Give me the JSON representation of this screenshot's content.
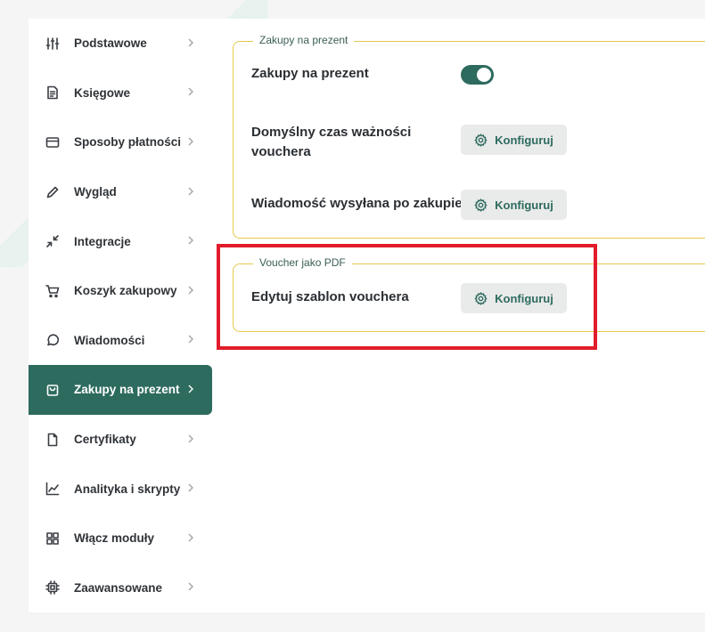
{
  "sidebar": {
    "items": [
      {
        "label": "Podstawowe",
        "icon": "sliders-icon"
      },
      {
        "label": "Księgowe",
        "icon": "document-icon"
      },
      {
        "label": "Sposoby płatności",
        "icon": "credit-card-icon"
      },
      {
        "label": "Wygląd",
        "icon": "pencil-icon"
      },
      {
        "label": "Integracje",
        "icon": "arrows-in-icon"
      },
      {
        "label": "Koszyk zakupowy",
        "icon": "cart-icon"
      },
      {
        "label": "Wiadomości",
        "icon": "chat-bubble-icon"
      },
      {
        "label": "Zakupy na prezent",
        "icon": "shopping-bag-icon",
        "active": true
      },
      {
        "label": "Certyfikaty",
        "icon": "file-icon"
      },
      {
        "label": "Analityka i skrypty",
        "icon": "chart-line-icon"
      },
      {
        "label": "Włącz moduły",
        "icon": "grid-icon"
      },
      {
        "label": "Zaawansowane",
        "icon": "chip-icon"
      }
    ]
  },
  "gift_section": {
    "legend": "Zakupy na prezent",
    "toggle_label": "Zakupy na prezent",
    "toggle_on": true,
    "validity_label_line1": "Domyślny czas ważności",
    "validity_label_line2": "vouchera",
    "message_label": "Wiadomość wysyłana po zakupie",
    "configure_label": "Konfiguruj"
  },
  "voucher_section": {
    "legend": "Voucher jako PDF",
    "edit_label": "Edytuj szablon vouchera",
    "configure_label": "Konfiguruj"
  },
  "colors": {
    "accent": "#2e6b5f",
    "border": "#e6c94a",
    "highlight": "#e11d2b"
  }
}
